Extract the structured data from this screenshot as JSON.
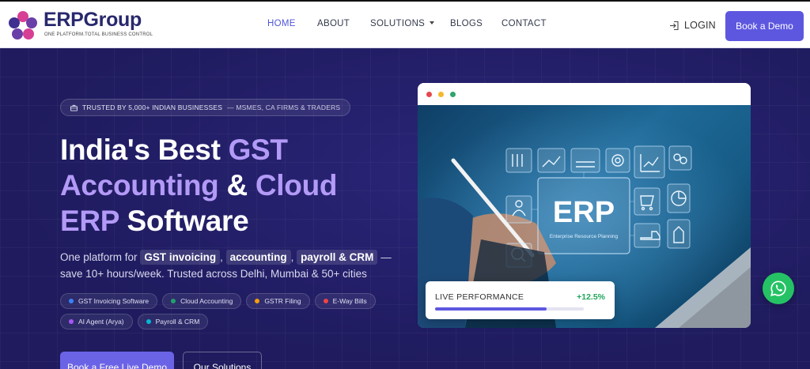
{
  "brand": {
    "name": "ERPGroup",
    "tagline": "ONE PLATFORM.TOTAL BUSINESS CONTROL"
  },
  "nav": {
    "items": [
      {
        "label": "HOME",
        "active": true
      },
      {
        "label": "ABOUT",
        "active": false
      },
      {
        "label": "SOLUTIONS",
        "active": false,
        "dropdown": true
      },
      {
        "label": "BLOGS",
        "active": false
      },
      {
        "label": "CONTACT",
        "active": false
      }
    ],
    "login_label": "LOGIN",
    "demo_label": "Book a Demo"
  },
  "hero": {
    "trust_badge": "TRUSTED BY 5,000+ INDIAN BUSINESSES",
    "trust_badge_tail": "— MSMES, CA FIRMS & TRADERS",
    "headline": {
      "l1_a": "India's Best ",
      "l1_b": "GST",
      "l2_a": "Accounting",
      "l2_b": " & ",
      "l2_c": "Cloud",
      "l3_a": "ERP",
      "l3_b": " Software"
    },
    "sub": {
      "prefix": "One platform for",
      "hl1": "GST invoicing",
      "comma": ",",
      "hl2": "accounting",
      "hl3": "payroll & CRM",
      "tail": "— save 10+ hours/week. Trusted across Delhi, Mumbai & 50+ cities"
    },
    "chips": [
      {
        "label": "GST Invoicing Software",
        "color": "#3b82f6"
      },
      {
        "label": "Cloud Accounting",
        "color": "#22a06b"
      },
      {
        "label": "GSTR Filing",
        "color": "#f59e0b"
      },
      {
        "label": "E-Way Bills",
        "color": "#ef4444"
      },
      {
        "label": "AI Agent (Arya)",
        "color": "#a855f7"
      },
      {
        "label": "Payroll & CRM",
        "color": "#06b6d4"
      }
    ],
    "cta_primary": "Book a Free Live Demo",
    "cta_secondary": "Our Solutions"
  },
  "mockup": {
    "window_dots": [
      "#e5484d",
      "#f5b82e",
      "#30a46c"
    ],
    "image_text": "ERP",
    "image_subtext": "Enterprise Resource Planning",
    "performance": {
      "label": "LIVE PERFORMANCE",
      "value": "+12.5%",
      "progress": 0.75
    }
  },
  "colors": {
    "accent": "#5d57e0",
    "hero_bg": "#1f1b5e",
    "highlight": "#b39af7",
    "whatsapp": "#25c265"
  }
}
